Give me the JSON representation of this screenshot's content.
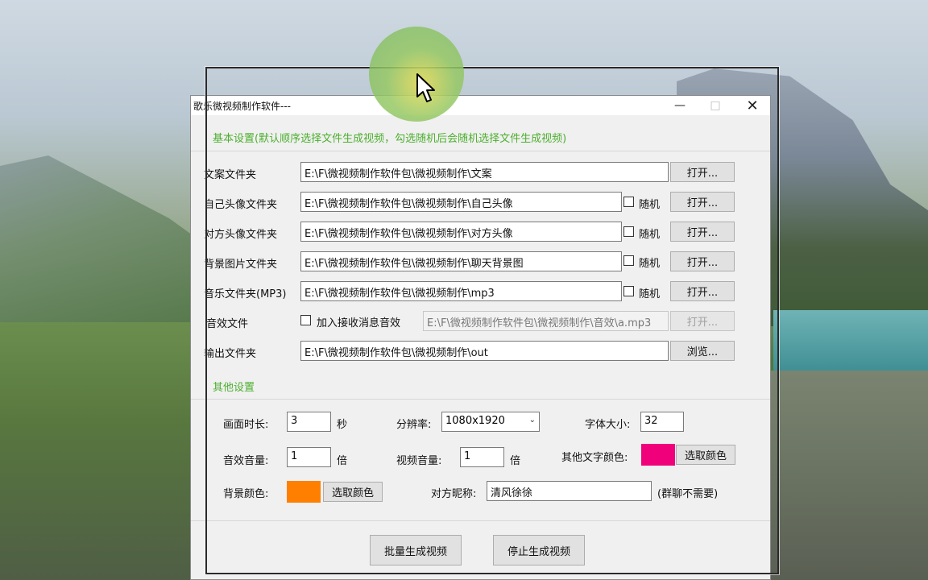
{
  "window": {
    "title": "歌乐微视频制作软件---",
    "minimize_icon": "minimize-icon",
    "maximize_icon": "maximize-icon",
    "close_icon": "close-icon"
  },
  "basic": {
    "section_title": "基本设置(默认顺序选择文件生成视频，勾选随机后会随机选择文件生成视频)",
    "rows": [
      {
        "label": "文案文件夹",
        "value": "E:\\F\\微视频制作软件包\\微视频制作\\文案",
        "random": null,
        "button": "打开..."
      },
      {
        "label": "自己头像文件夹",
        "value": "E:\\F\\微视频制作软件包\\微视频制作\\自己头像",
        "random": "随机",
        "button": "打开..."
      },
      {
        "label": "对方头像文件夹",
        "value": "E:\\F\\微视频制作软件包\\微视频制作\\对方头像",
        "random": "随机",
        "button": "打开..."
      },
      {
        "label": "背景图片文件夹",
        "value": "E:\\F\\微视频制作软件包\\微视频制作\\聊天背景图",
        "random": "随机",
        "button": "打开..."
      },
      {
        "label": "音乐文件夹(MP3)",
        "value": "E:\\F\\微视频制作软件包\\微视频制作\\mp3",
        "random": "随机",
        "button": "打开..."
      }
    ],
    "sound_label": "音效文件",
    "sound_checkbox": "加入接收消息音效",
    "sound_value": "E:\\F\\微视频制作软件包\\微视频制作\\音效\\a.mp3",
    "sound_button": "打开...",
    "output_label": "输出文件夹",
    "output_value": "E:\\F\\微视频制作软件包\\微视频制作\\out",
    "output_button": "浏览..."
  },
  "other": {
    "section_title": "其他设置",
    "duration_label": "画面时长:",
    "duration_value": "3",
    "duration_unit": "秒",
    "resolution_label": "分辨率:",
    "resolution_value": "1080x1920",
    "font_size_label": "字体大小:",
    "font_size_value": "32",
    "sfx_volume_label": "音效音量:",
    "sfx_volume_value": "1",
    "sfx_volume_unit": "倍",
    "video_volume_label": "视频音量:",
    "video_volume_value": "1",
    "video_volume_unit": "倍",
    "text_color_label": "其他文字颜色:",
    "text_color": "#f0007a",
    "text_color_button": "选取颜色",
    "bg_color_label": "背景颜色:",
    "bg_color": "#ff8000",
    "bg_color_button": "选取颜色",
    "nickname_label": "对方昵称:",
    "nickname_value": "清风徐徐",
    "nickname_note": "(群聊不需要)"
  },
  "actions": {
    "batch_button": "批量生成视频",
    "stop_button": "停止生成视频"
  },
  "colors": {
    "section_title": "#4caf2e",
    "cursor_halo": "#8cc86a"
  }
}
